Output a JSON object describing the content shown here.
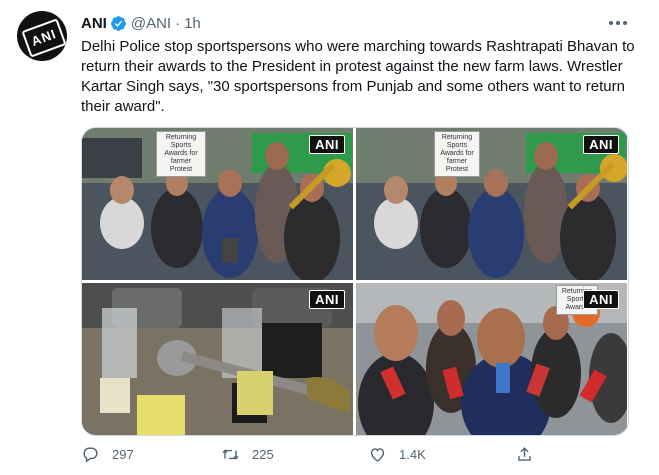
{
  "tweet": {
    "author_name": "ANI",
    "handle": "@ANI",
    "separator": "·",
    "time": "1h",
    "text": "Delhi Police stop sportspersons who were marching towards Rashtrapati Bhavan to return their awards to the President in protest against the new farm laws. Wrestler Kartar Singh says, \"30 sportspersons from Punjab and some others want to return their award\".",
    "verified_color": "#1d9bf0"
  },
  "media": {
    "photos": [
      {
        "badge": "ANI",
        "placard": "Returning Sports Awards for farmer Protest"
      },
      {
        "badge": "ANI",
        "placard": "Returning Sports Awards for farmer Protest"
      },
      {
        "badge": "ANI"
      },
      {
        "badge": "ANI",
        "placard": "Returning Sports Awards"
      }
    ]
  },
  "actions": {
    "reply_count": "297",
    "retweet_count": "225",
    "like_count": "1.4K"
  },
  "icons": [
    "avatar",
    "verified-icon",
    "more-icon",
    "reply-icon",
    "retweet-icon",
    "like-icon",
    "share-icon"
  ]
}
